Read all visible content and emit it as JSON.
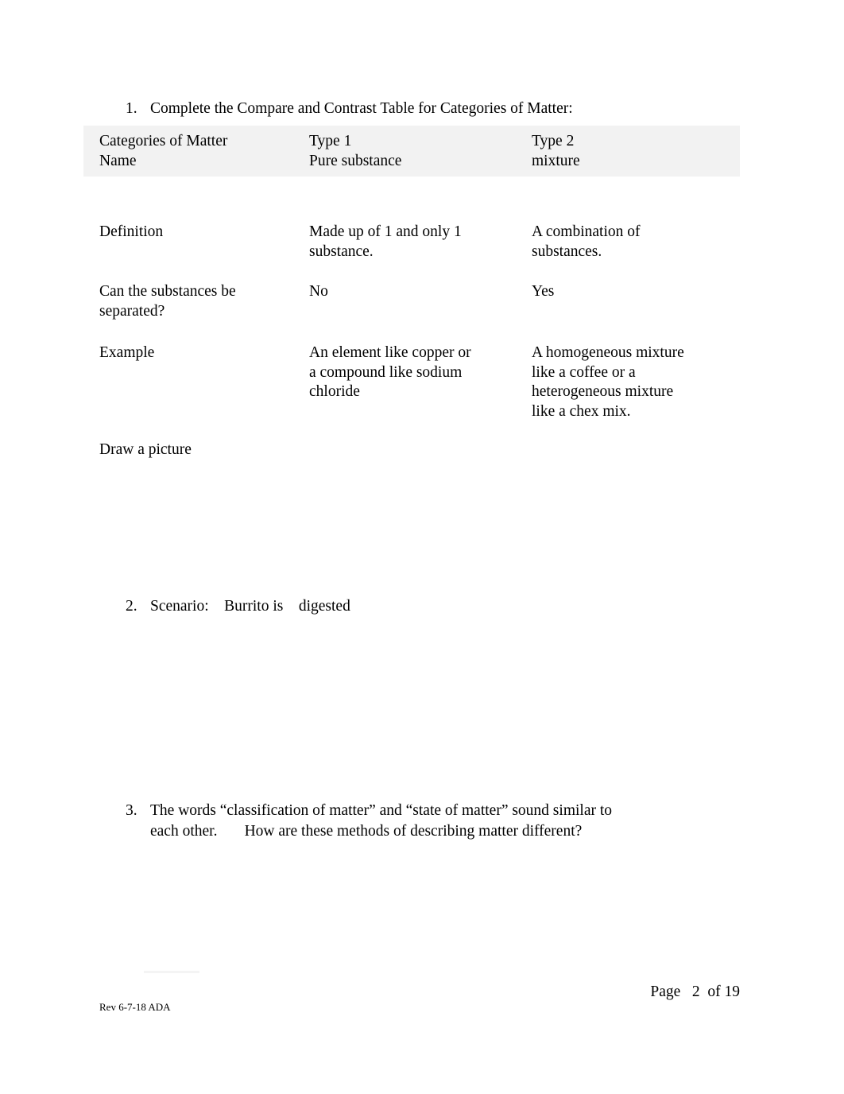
{
  "document": {
    "page_label": "Page   2  of 19",
    "revision": "Rev 6-7-18 ADA"
  },
  "items": [
    {
      "number": "1.",
      "text": "Complete the Compare and Contrast Table for Categories of Matter:"
    },
    {
      "number": "2.",
      "text": "Scenario:    Burrito is    digested"
    },
    {
      "number": "3.",
      "line1": "The words “classification of matter” and “state of matter” sound similar to",
      "line2": "each other.       How are these methods of describing matter different?"
    }
  ],
  "table": {
    "header": {
      "col1_line1": "Categories of Matter",
      "col1_line2": "Name",
      "col2_line1": "Type 1",
      "col2_line2": "Pure substance",
      "col3_line1": "Type 2",
      "col3_line2": "mixture"
    },
    "rows": [
      {
        "label": "Definition",
        "type1": "Made up of 1 and only 1\nsubstance.",
        "type2": "A combination of\nsubstances."
      },
      {
        "label": "Can the substances be\nseparated?",
        "type1": "No",
        "type2": "Yes"
      },
      {
        "label": "Example",
        "type1": "An element like copper or\na compound like sodium\nchloride",
        "type2": "A homogeneous mixture\nlike a coffee or a\nheterogeneous mixture\nlike a chex mix."
      },
      {
        "label": "Draw a picture",
        "type1": "",
        "type2": ""
      }
    ]
  },
  "colors": {
    "header_band": "#f2f2f2",
    "text": "#000000",
    "page_background": "#ffffff"
  }
}
